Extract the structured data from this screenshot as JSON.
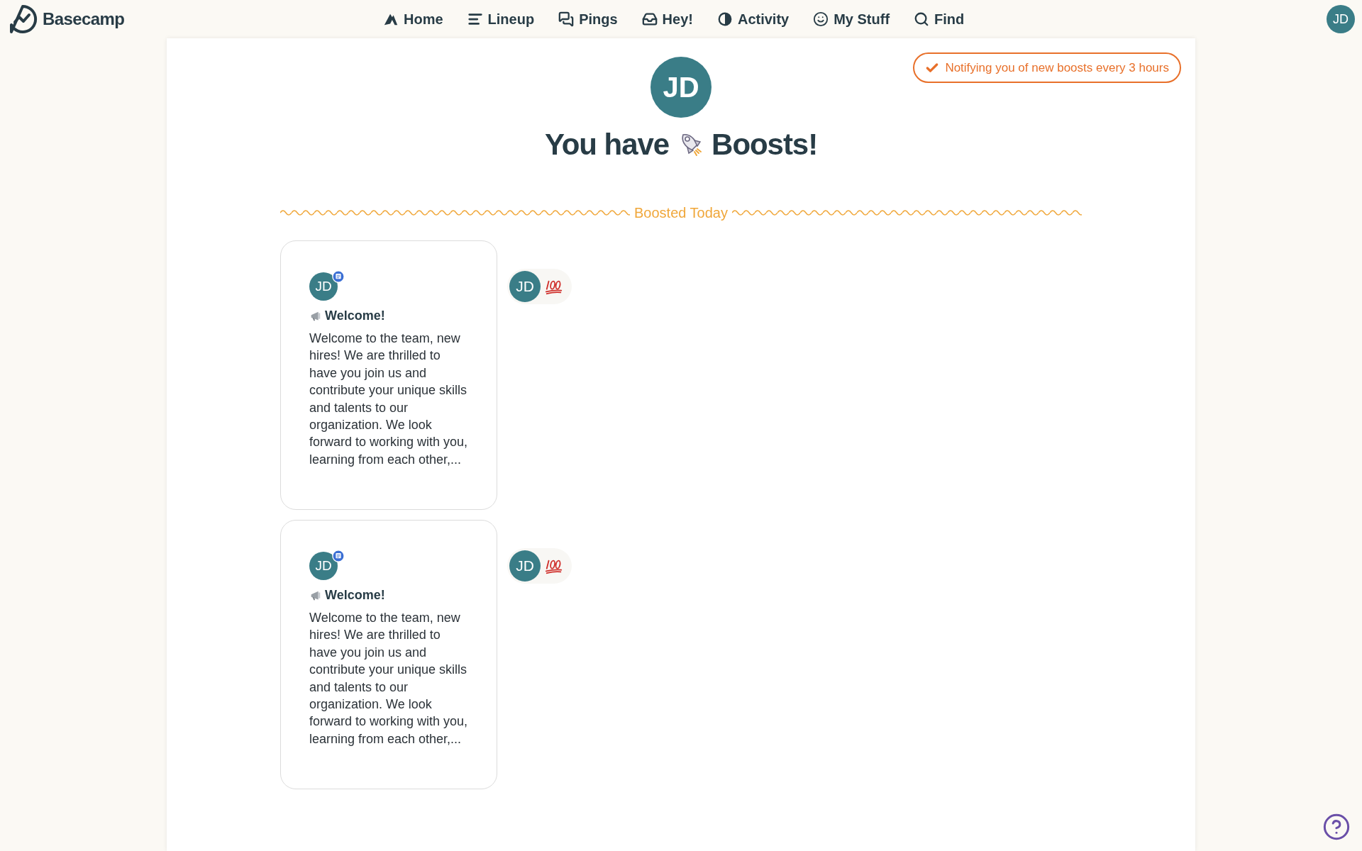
{
  "app": {
    "name": "Basecamp"
  },
  "nav": [
    {
      "label": "Home",
      "kind": "home"
    },
    {
      "label": "Lineup",
      "kind": "lineup"
    },
    {
      "label": "Pings",
      "kind": "pings"
    },
    {
      "label": "Hey!",
      "kind": "hey"
    },
    {
      "label": "Activity",
      "kind": "activity"
    },
    {
      "label": "My Stuff",
      "kind": "mystuff"
    },
    {
      "label": "Find",
      "kind": "find"
    }
  ],
  "user": {
    "initials": "JD"
  },
  "notify": {
    "label": "Notifying you of new boosts every 3 hours",
    "checked": true
  },
  "header": {
    "initials": "JD",
    "title_before": "You have",
    "title_after": "Boosts!"
  },
  "section": {
    "title": "Boosted Today"
  },
  "boosts": [
    {
      "author_initials": "JD",
      "title": "Welcome!",
      "excerpt": "Welcome to the team, new hires! We are thrilled to have you join us and contribute your unique skills and talents to our organization. We look forward to working with you, learning from each other,...",
      "booster_initials": "JD"
    },
    {
      "author_initials": "JD",
      "title": "Welcome!",
      "excerpt": "Welcome to the team, new hires! We are thrilled to have you join us and contribute your unique skills and talents to our organization. We look forward to working with you, learning from each other,...",
      "booster_initials": "JD"
    }
  ]
}
